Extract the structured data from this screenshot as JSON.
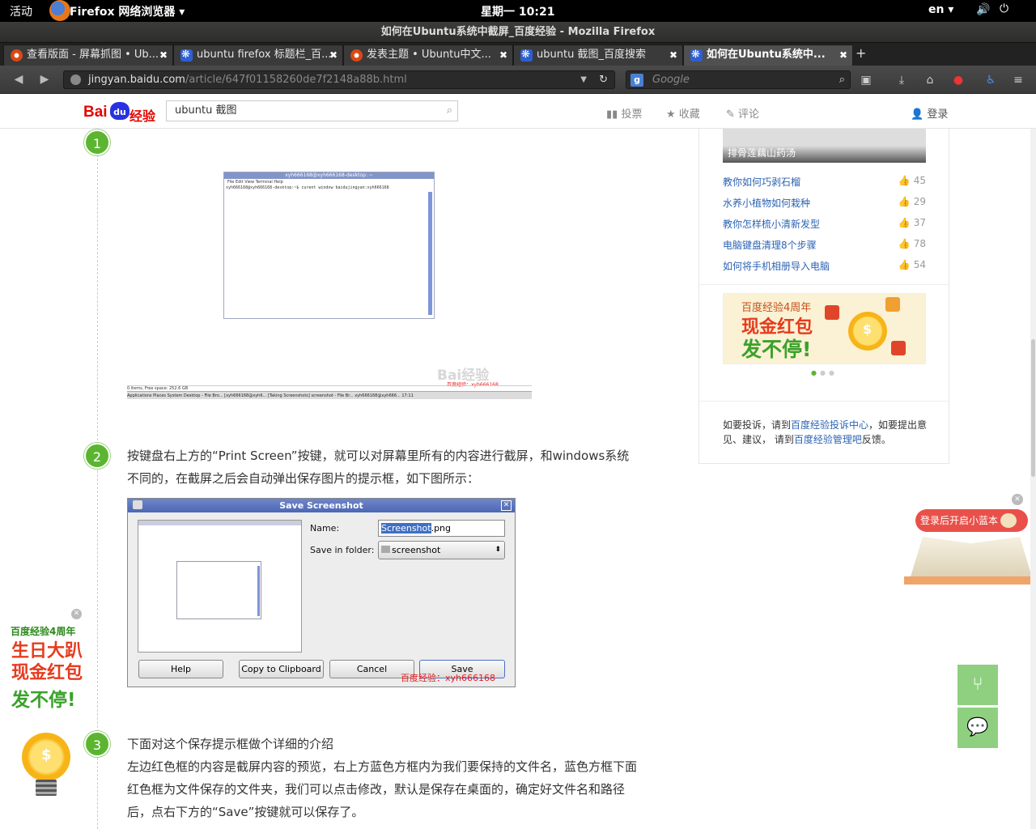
{
  "topbar": {
    "activities": "活动",
    "app_name": "Firefox 网络浏览器 ▾",
    "clock": "星期一 10:21",
    "lang": "en ▾",
    "volume_icon": "volume-icon",
    "power_icon": "power-icon"
  },
  "window": {
    "title": "如何在Ubuntu系统中截屏_百度经验 - Mozilla Firefox"
  },
  "tabs": [
    {
      "label": "查看版面 - 屏幕抓图 • Ub...",
      "favicon": "ubuntu-icon"
    },
    {
      "label": "ubuntu firefox 标题栏_百...",
      "favicon": "paw-icon"
    },
    {
      "label": "发表主题 • Ubuntu中文...",
      "favicon": "ubuntu-icon"
    },
    {
      "label": "ubuntu 截图_百度搜索",
      "favicon": "paw-icon"
    },
    {
      "label": "如何在Ubuntu系统中...",
      "favicon": "paw-icon",
      "active": true
    }
  ],
  "navbar": {
    "url_host": "jingyan.baidu.com",
    "url_path": "/article/647f01158260de7f2148a88b.html",
    "search_placeholder": "Google"
  },
  "header": {
    "search_value": "ubuntu 截图",
    "vote": "投票",
    "collect": "收藏",
    "comment": "评论",
    "login": "登录",
    "logo_bai": "Bai",
    "logo_du": "du",
    "logo_jingyan": "经验"
  },
  "steps": [
    {
      "num": "1"
    },
    {
      "num": "2",
      "text": "按键盘右上方的“Print Screen”按键，就可以对屏幕里所有的内容进行截屏，和windows系统不同的，在截屏之后会自动弹出保存图片的提示框，如下图所示："
    },
    {
      "num": "3",
      "line1": "下面对这个保存提示框做个详细的介绍",
      "line2": "左边红色框的内容是截屏内容的预览，右上方蓝色方框内为我们要保持的文件名，蓝色方框下面红色框为文件保存的文件夹，我们可以点击修改，默认是保存在桌面的，确定好文件名和路径后，点右下方的“Save”按键就可以保存了。"
    }
  ],
  "shot1": {
    "window_title": "xyh666168@xyh666168-desktop: ~",
    "menu": "File  Edit  View  Terminal  Help",
    "command": "xyh666168@xyh666168-desktop:~$ curent window baidujingyan:xyh666168",
    "status": "0 items, Free space: 252.6 GB",
    "taskbar": "Applications  Places  System    Desktop - File Bro...   [xyh666168@xyh6...   [Taking Screenshots]   screenshot - File Br...   xyh666168@xyh666...   17:11",
    "watermark": "Bai经验",
    "watermark_sub": "百度经验：xyh666168"
  },
  "dialog": {
    "title": "Save Screenshot",
    "name_label": "Name:",
    "name_selected": "Screenshot",
    "name_ext": ".png",
    "folder_label": "Save in folder:",
    "folder_value": "screenshot",
    "help": "Help",
    "copy": "Copy to Clipboard",
    "cancel": "Cancel",
    "save": "Save",
    "watermark": "百度经验：xyh666168"
  },
  "sidebar": {
    "thumb_caption": "排骨莲藕山药汤",
    "related": [
      {
        "title": "教你如何巧剥石榴",
        "count": "45"
      },
      {
        "title": "水养小植物如何栽种",
        "count": "29"
      },
      {
        "title": "教你怎样梳小清新发型",
        "count": "37"
      },
      {
        "title": "电脑键盘清理8个步骤",
        "count": "78"
      },
      {
        "title": "如何将手机相册导入电脑",
        "count": "54"
      }
    ],
    "banner": {
      "line1": "百度经验4周年",
      "line2": "现金红包",
      "line3": "发不停!"
    },
    "notice": {
      "p1": "如要投诉，请到",
      "link1": "百度经验投诉中心",
      "p2": "，如要提出意见、建议， 请到",
      "link2": "百度经验管理吧",
      "p3": "反馈。"
    }
  },
  "leftad": {
    "line1": "百度经验4周年",
    "line2": "生日大趴",
    "line3": "现金红包",
    "line4": "发不停!"
  },
  "rightad": {
    "label": "登录后开启小蓝本"
  }
}
